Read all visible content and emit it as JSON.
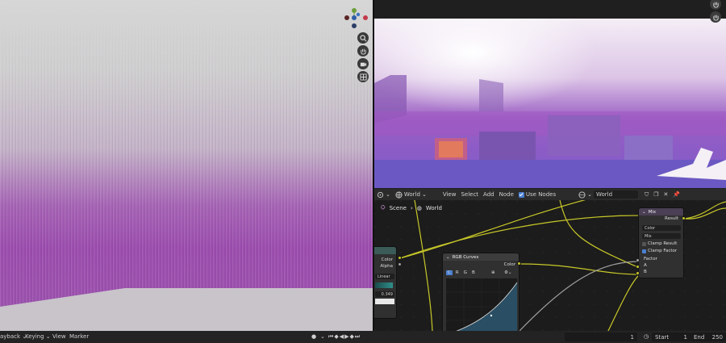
{
  "node_editor_header": {
    "menu": [
      "View",
      "Select",
      "Add",
      "Node"
    ],
    "world_selector": "World",
    "use_nodes_label": "Use Nodes",
    "world_datablock": "World"
  },
  "breadcrumb": {
    "scene": "Scene",
    "world": "World"
  },
  "nodes": {
    "left_partial": {
      "out_color": "Color",
      "out_alpha": "Alpha",
      "interp": "Linear",
      "value": "0.349"
    },
    "rgb_curves": {
      "title": "RGB Curves",
      "out_color": "Color",
      "channels": [
        "C",
        "R",
        "G",
        "B"
      ]
    },
    "mix": {
      "title": "Mix",
      "out_result": "Result",
      "data_type": "Color",
      "blend_mode": "Mix",
      "clamp_result": "Clamp Result",
      "clamp_factor": "Clamp Factor",
      "in_factor": "Factor",
      "in_a": "A",
      "in_b": "B"
    }
  },
  "timeline": {
    "playback": "ayback",
    "keying": "Keying",
    "view": "View",
    "marker": "Marker",
    "current_frame": "1",
    "start_label": "Start",
    "start_value": "1",
    "end_label": "End",
    "end_value": "250"
  },
  "colors": {
    "accent": "#4b7fd0",
    "socket_color": "#c7c729",
    "socket_gray": "#a1a1a1",
    "node_header": "#3d3d3d"
  }
}
